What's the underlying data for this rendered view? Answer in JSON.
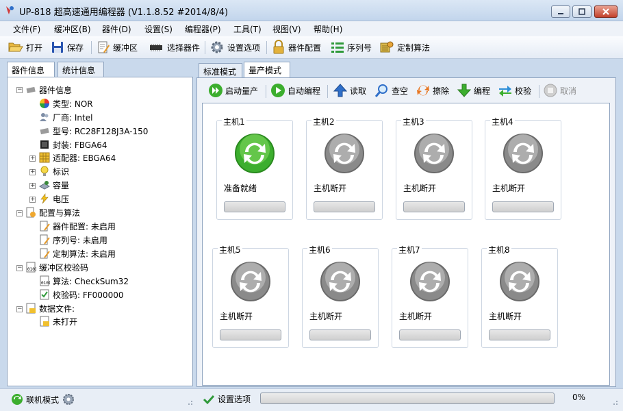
{
  "window": {
    "title": "UP-818 超高速通用编程器  (V1.1.8.52 #2014/8/4)"
  },
  "menu": [
    "文件(F)",
    "缓冲区(B)",
    "器件(D)",
    "设置(S)",
    "编程器(P)",
    "工具(T)",
    "视图(V)",
    "帮助(H)"
  ],
  "toolbar": {
    "open": "打开",
    "save": "保存",
    "buffer": "缓冲区",
    "select_device": "选择器件",
    "settings": "设置选项",
    "device_config": "器件配置",
    "serial": "序列号",
    "custom_algo": "定制算法"
  },
  "left_tabs": [
    "器件信息",
    "统计信息"
  ],
  "tree": {
    "device_info": "器件信息",
    "type": "类型: NOR",
    "vendor": "厂商: Intel",
    "model": "型号: RC28F128J3A-150",
    "package": "封装: FBGA64",
    "adapter": "适配器: EBGA64",
    "mark": "标识",
    "capacity": "容量",
    "voltage": "电压",
    "config_algo": "配置与算法",
    "dev_config": "器件配置: 未启用",
    "serial_no": "序列号: 未启用",
    "custom": "定制算法: 未启用",
    "buffer_checksum": "缓冲区校验码",
    "algorithm": "算法: CheckSum32",
    "checksum": "校验码: FF000000",
    "data_file": "数据文件:",
    "not_opened": "未打开"
  },
  "right_tabs": [
    "标准模式",
    "量产模式"
  ],
  "actions": {
    "start_mass": "启动量产",
    "auto_program": "自动编程",
    "read": "读取",
    "blank_check": "查空",
    "erase": "擦除",
    "program": "编程",
    "verify": "校验",
    "cancel": "取消"
  },
  "hosts": [
    {
      "name": "主机1",
      "status": "准备就绪",
      "ready": true
    },
    {
      "name": "主机2",
      "status": "主机断开",
      "ready": false
    },
    {
      "name": "主机3",
      "status": "主机断开",
      "ready": false
    },
    {
      "name": "主机4",
      "status": "主机断开",
      "ready": false
    },
    {
      "name": "主机5",
      "status": "主机断开",
      "ready": false
    },
    {
      "name": "主机6",
      "status": "主机断开",
      "ready": false
    },
    {
      "name": "主机7",
      "status": "主机断开",
      "ready": false
    },
    {
      "name": "主机8",
      "status": "主机断开",
      "ready": false
    }
  ],
  "status": {
    "mode": "联机模式",
    "settings": "设置选项",
    "progress": "0%"
  },
  "colors": {
    "ready_green": "#3cae2e",
    "disconnected_gray": "#8a8a8a",
    "accent_blue": "#2f6fc9"
  }
}
